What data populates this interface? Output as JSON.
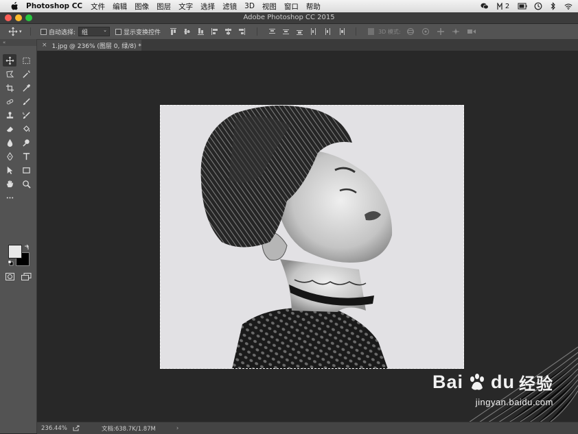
{
  "menubar": {
    "app": "Photoshop CC",
    "items": [
      "文件",
      "编辑",
      "图像",
      "图层",
      "文字",
      "选择",
      "滤镜",
      "3D",
      "视图",
      "窗口",
      "帮助"
    ],
    "right_badge": "2",
    "icons": [
      "apple-icon",
      "wechat-icon",
      "notification-icon",
      "battery-icon",
      "time-machine-icon",
      "bluetooth-icon",
      "wifi-icon"
    ]
  },
  "window": {
    "title": "Adobe Photoshop CC 2015"
  },
  "options": {
    "auto_select_label": "自动选择:",
    "group_value": "组",
    "show_transform_label": "显示变换控件",
    "mode_3d_label": "3D 模式:"
  },
  "toolbar": {
    "collapse": "«"
  },
  "document": {
    "tab_title": "1.jpg @ 236% (图层 0, 绿/8) *",
    "close": "×"
  },
  "status": {
    "zoom": "236.44%",
    "doc_info": "文档:638.7K/1.87M",
    "more": "›"
  },
  "watermark": {
    "brand_bai": "Bai",
    "brand_du": "du",
    "brand_cn": "经验",
    "url": "jingyan.baidu.com"
  },
  "colors": {
    "foreground": "#e8e8e8",
    "background": "#000000",
    "ui_panel": "#535353",
    "canvas_bg": "#282828"
  }
}
